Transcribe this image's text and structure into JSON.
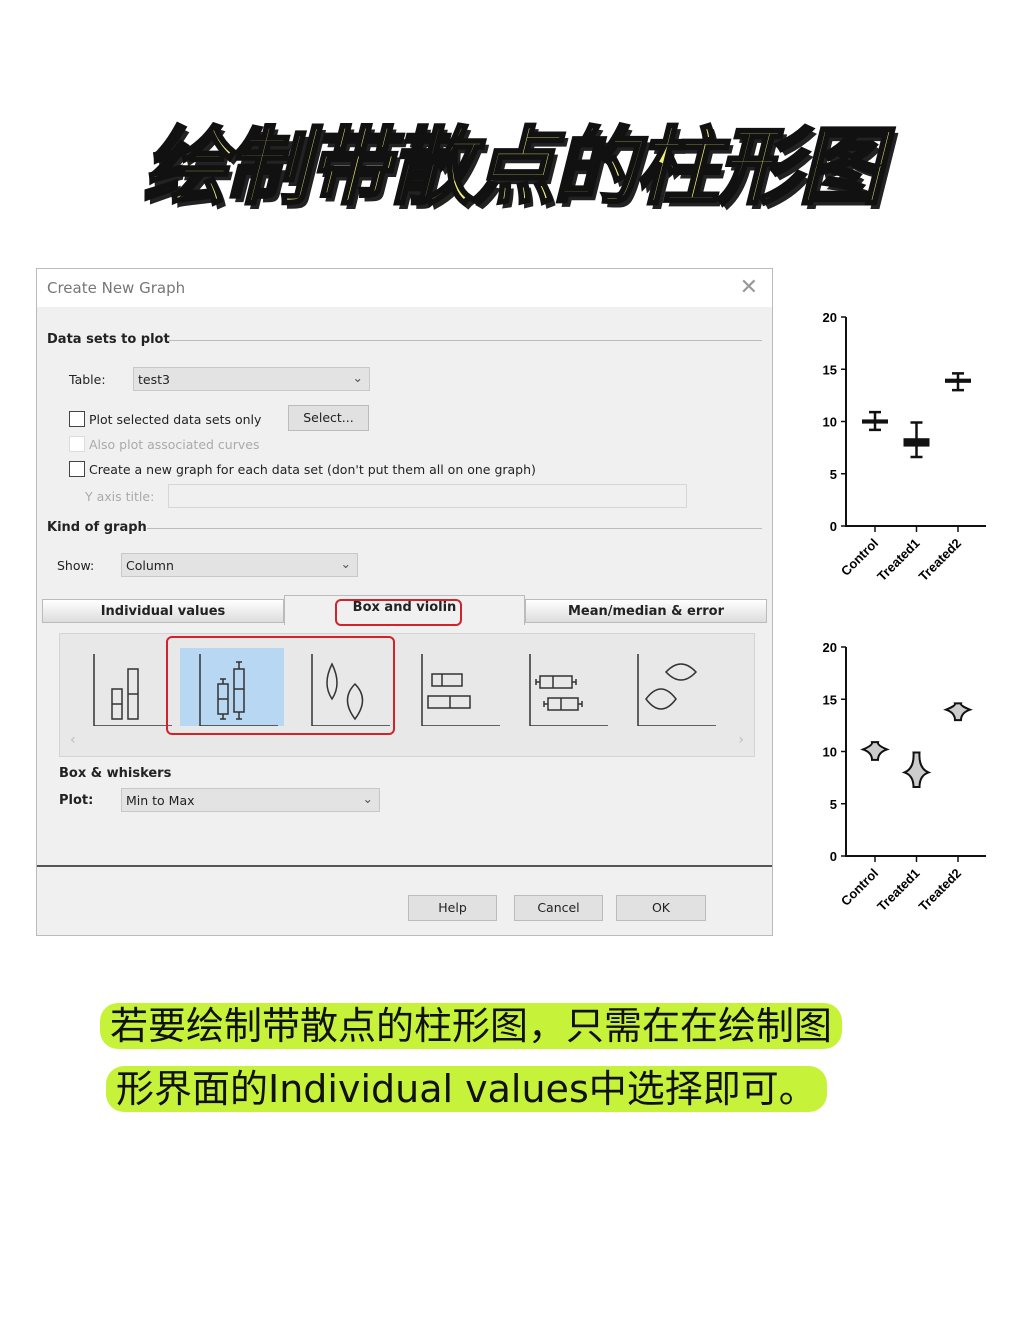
{
  "headline": "绘制带散点的柱形图",
  "dialog": {
    "title": "Create New Graph",
    "close_icon": "close-icon",
    "data_sets_section": "Data sets to plot",
    "table_label": "Table:",
    "table_value": "test3",
    "plot_selected_label": "Plot selected data sets only",
    "select_button": "Select...",
    "also_plot_label": "Also plot associated curves",
    "new_graph_label": "Create a new graph for each data set (don't put them all on one graph)",
    "y_axis_title_label": "Y axis title:",
    "y_axis_title_value": "",
    "kind_section": "Kind of graph",
    "show_label": "Show:",
    "show_value": "Column",
    "tabs": [
      {
        "label": "Individual values"
      },
      {
        "label": "Box and violin",
        "active": true
      },
      {
        "label": "Mean/median & error"
      }
    ],
    "gallery": [
      "column-bars-icon",
      "box-whiskers-icon",
      "violin-icon",
      "horizontal-bars-icon",
      "horizontal-box-icon",
      "horizontal-violin-icon"
    ],
    "gallery_selected": "box-whiskers-icon",
    "box_section": "Box & whiskers",
    "plot_label": "Plot:",
    "plot_value": "Min to Max",
    "help_button": "Help",
    "cancel_button": "Cancel",
    "ok_button": "OK",
    "highlight_color": "#d2232a"
  },
  "caption": {
    "line1": "若要绘制带散点的柱形图，只需在在绘制图",
    "line2": "形界面的Individual values中选择即可。",
    "highlight_color": "#c6f23a"
  },
  "chart_data": [
    {
      "type": "box",
      "categories": [
        "Control",
        "Treated1",
        "Treated2"
      ],
      "ylim": [
        0,
        20
      ],
      "yticks": [
        0,
        5,
        10,
        15,
        20
      ],
      "values": [
        {
          "min": 9.2,
          "q1": 9.8,
          "median": 10,
          "q3": 10.2,
          "max": 10.9
        },
        {
          "min": 6.6,
          "q1": 7.6,
          "median": 8,
          "q3": 8.4,
          "max": 9.9
        },
        {
          "min": 13,
          "q1": 13.7,
          "median": 13.9,
          "q3": 14.1,
          "max": 14.6
        }
      ]
    },
    {
      "type": "violin",
      "categories": [
        "Control",
        "Treated1",
        "Treated2"
      ],
      "ylim": [
        0,
        20
      ],
      "yticks": [
        0,
        5,
        10,
        15,
        20
      ],
      "values": [
        {
          "min": 9.2,
          "median": 10.2,
          "max": 10.9
        },
        {
          "min": 6.6,
          "median": 8,
          "max": 9.9
        },
        {
          "min": 13,
          "median": 14,
          "max": 14.6
        }
      ]
    }
  ]
}
